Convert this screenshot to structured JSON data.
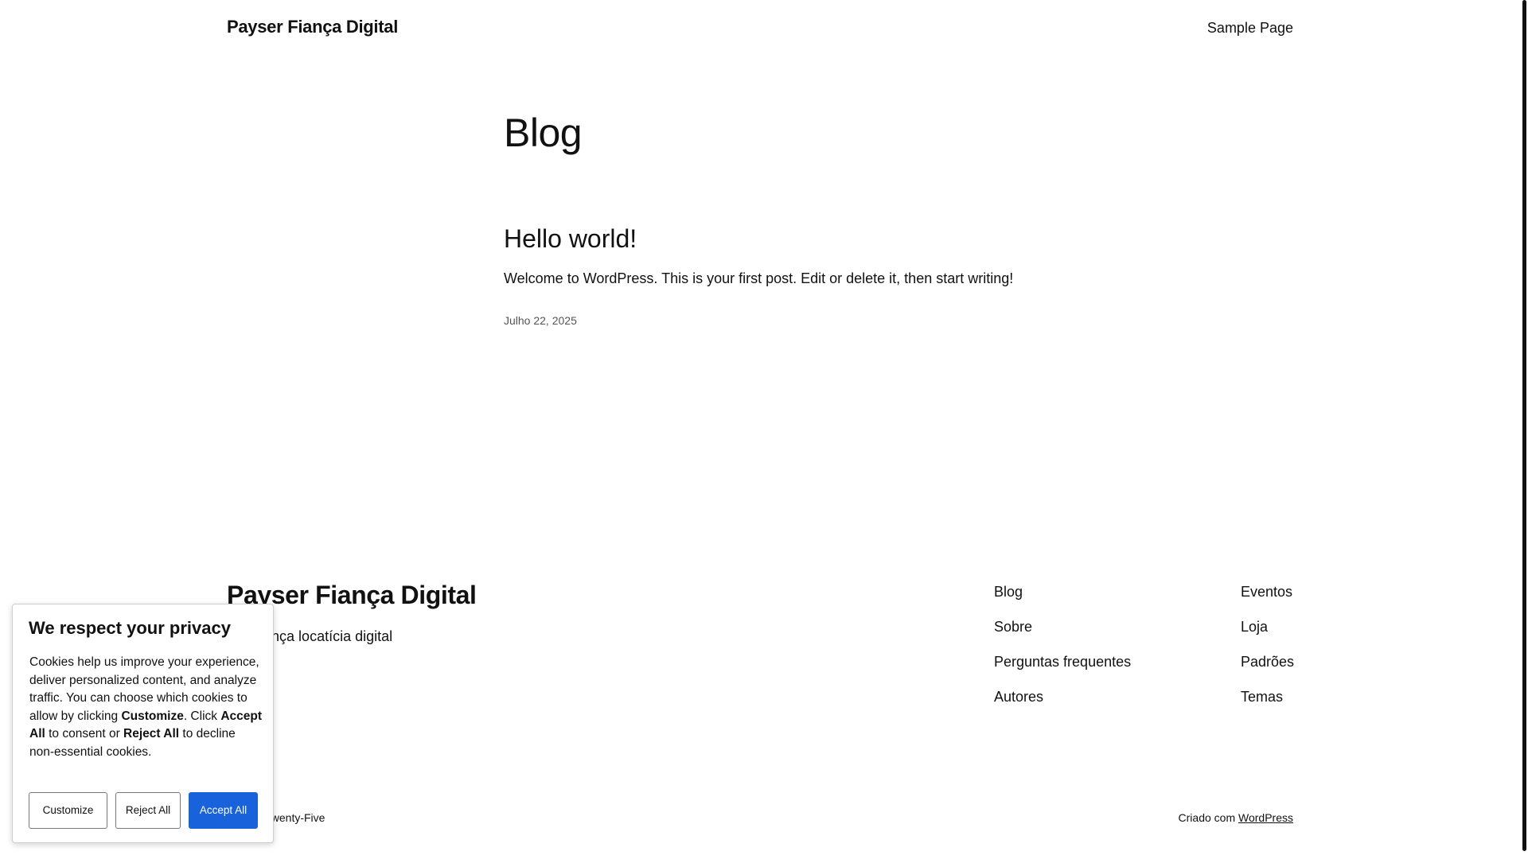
{
  "header": {
    "site_title": "Payser Fiança Digital",
    "nav": [
      "Sample Page"
    ]
  },
  "main": {
    "heading": "Blog",
    "post": {
      "title": "Hello world!",
      "excerpt": "Welcome to WordPress. This is your first post. Edit or delete it, then start writing!",
      "date": "Julho 22, 2025"
    }
  },
  "footer": {
    "title": "Payser Fiança Digital",
    "tagline": "Sua fiança locatícia digital",
    "col_a": [
      "Blog",
      "Sobre",
      "Perguntas frequentes",
      "Autores"
    ],
    "col_b": [
      "Eventos",
      "Loja",
      "Padrões",
      "Temas"
    ],
    "theme_credit": "Twenty Twenty-Five",
    "powered_prefix": "Criado com",
    "powered_link": "WordPress"
  },
  "cookie": {
    "title": "We respect your privacy",
    "text_1": "Cookies help us improve your experience, deliver personalized content, and analyze traffic. You can choose which cookies to allow by clicking ",
    "text_customize": "Customize",
    "text_2": ". Click ",
    "text_accept": "Accept All",
    "text_3": " to consent or ",
    "text_reject": "Reject All",
    "text_4": " to decline non-essential cookies.",
    "buttons": {
      "customize": "Customize",
      "reject": "Reject All",
      "accept": "Accept All"
    },
    "accent_color": "#1863dc"
  }
}
